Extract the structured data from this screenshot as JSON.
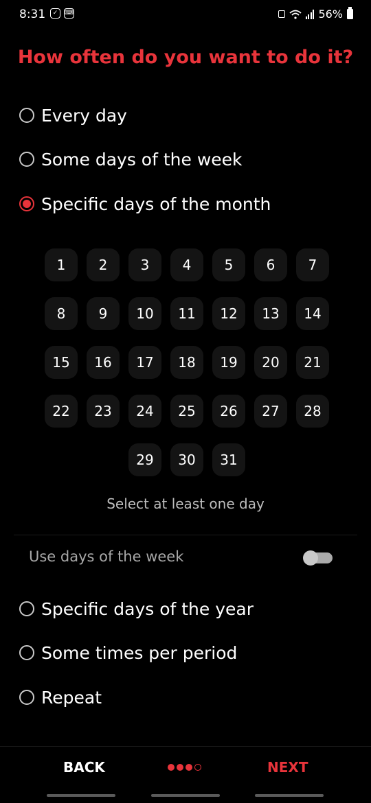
{
  "status": {
    "time": "8:31",
    "battery": "56%",
    "icons": [
      "check-square-icon",
      "keyboard-icon",
      "lock-icon",
      "wifi-icon",
      "signal-icon",
      "battery-icon"
    ]
  },
  "title": "How often do you want to do it?",
  "options_top": [
    {
      "label": "Every day",
      "selected": false
    },
    {
      "label": "Some days of the week",
      "selected": false
    },
    {
      "label": "Specific days of the month",
      "selected": true
    }
  ],
  "days": [
    [
      "1",
      "2",
      "3",
      "4",
      "5",
      "6",
      "7"
    ],
    [
      "8",
      "9",
      "10",
      "11",
      "12",
      "13",
      "14"
    ],
    [
      "15",
      "16",
      "17",
      "18",
      "19",
      "20",
      "21"
    ],
    [
      "22",
      "23",
      "24",
      "25",
      "26",
      "27",
      "28"
    ],
    [
      "29",
      "30",
      "31"
    ]
  ],
  "hint": "Select at least one day",
  "use_days_of_week": {
    "label": "Use days of the week",
    "enabled": false
  },
  "options_bottom": [
    {
      "label": "Specific days of the year",
      "selected": false
    },
    {
      "label": "Some times per period",
      "selected": false
    },
    {
      "label": "Repeat",
      "selected": false
    }
  ],
  "footer": {
    "back_label": "BACK",
    "next_label": "NEXT",
    "step_current": 3,
    "step_total": 4
  },
  "colors": {
    "accent": "#e8343b",
    "background": "#000000",
    "day_tile": "#141414"
  }
}
